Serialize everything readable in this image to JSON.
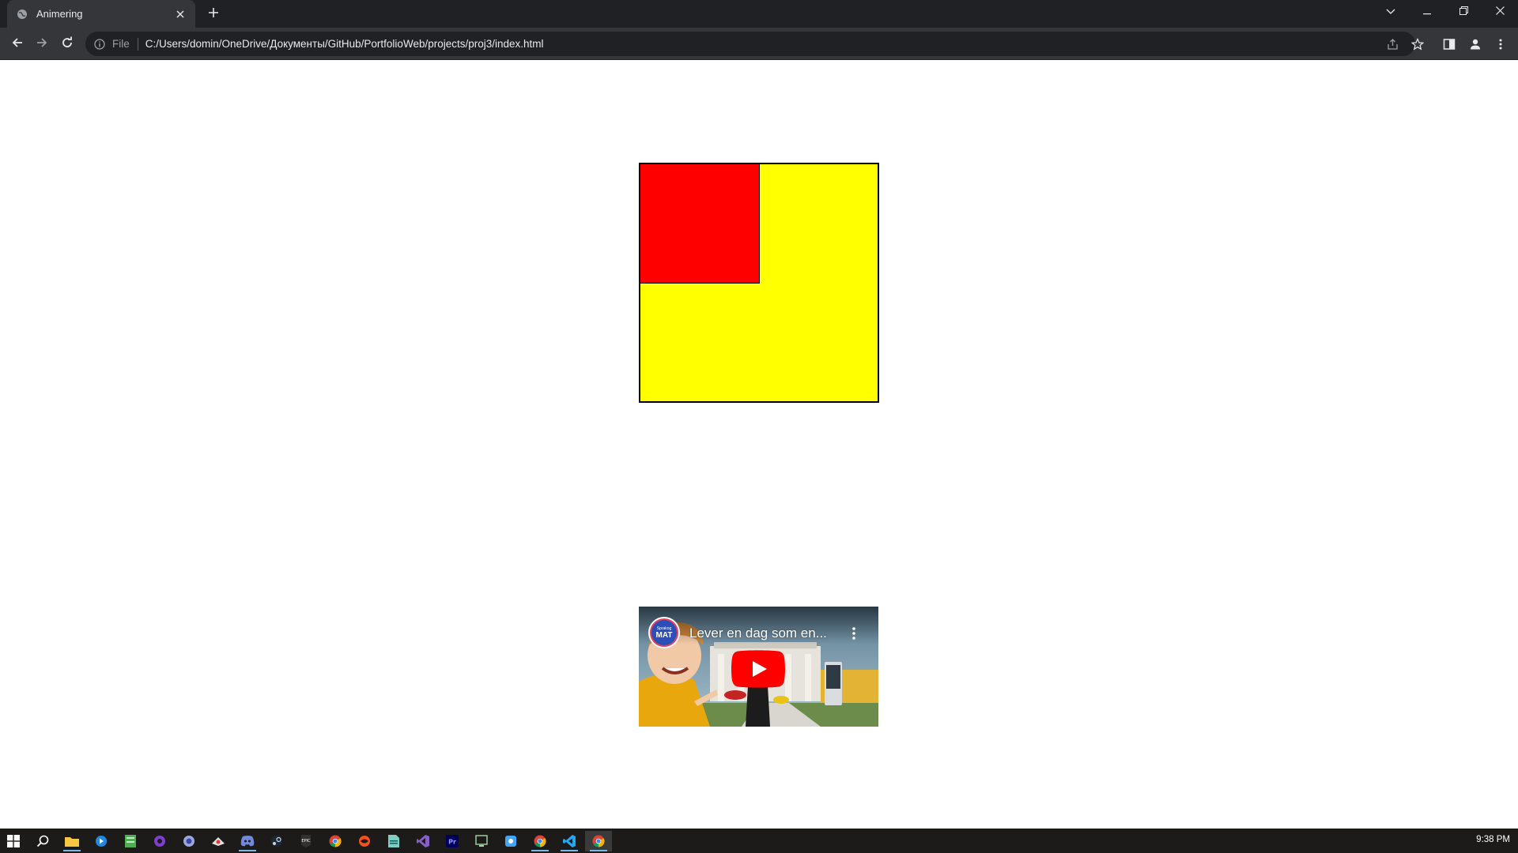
{
  "browser": {
    "tab": {
      "title": "Animering",
      "favicon": "globe-icon",
      "close_icon": "close-icon"
    },
    "new_tab_icon": "plus-icon",
    "window_controls": [
      "chevron-down-icon",
      "minimize-icon",
      "restore-icon",
      "close-icon"
    ],
    "omnibox": {
      "info_icon": "info-icon",
      "scheme": "File",
      "url": "C:/Users/domin/OneDrive/Документы/GitHub/PortfolioWeb/projects/proj3/index.html"
    }
  },
  "page": {
    "yellow_box_color": "#ffff00",
    "red_box_color": "#ff0000",
    "video": {
      "title": "Lever en dag som en...",
      "channel_badge_small": "Sprakog",
      "channel_badge": "MAT"
    }
  },
  "taskbar": {
    "icons": [
      "windows-start-icon",
      "search-icon",
      "file-explorer-icon",
      "app-icon",
      "app-icon",
      "app-icon",
      "app-icon",
      "app-icon",
      "discord-icon",
      "steam-icon",
      "epic-games-icon",
      "chrome-icon",
      "app-icon",
      "app-icon",
      "visual-studio-icon",
      "premiere-pro-icon",
      "app-icon",
      "app-icon",
      "chrome-icon",
      "vscode-icon",
      "chrome-icon"
    ],
    "clock": "9:38 PM"
  }
}
